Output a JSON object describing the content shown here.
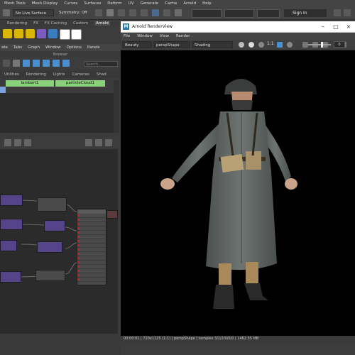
{
  "maya": {
    "menubar": [
      "Mesh Tools",
      "Mesh Display",
      "Curves",
      "Surfaces",
      "Deform",
      "UV",
      "Generate",
      "Cache",
      "Arnold",
      "Help"
    ],
    "status_line": {
      "live_surface": "No Live Surface",
      "symmetry": "Symmetry: Off",
      "sign_in": "Sign In"
    },
    "shelf_tabs": [
      "Rendering",
      "FX",
      "FX Caching",
      "Custom",
      "Arnold"
    ],
    "shelf_active": "Arnold"
  },
  "hypershade": {
    "menu": [
      "ate",
      "Tabs",
      "Graph",
      "Window",
      "Options",
      "Panels"
    ],
    "browser_title": "Browser",
    "search_placeholder": "Search...",
    "tabs": [
      "Utilities",
      "Rendering",
      "Lights",
      "Cameras",
      "Shad"
    ],
    "materials": [
      "lambert1",
      "particleCloud1"
    ]
  },
  "render_view": {
    "title": "Arnold RenderView",
    "menu": [
      "File",
      "Window",
      "View",
      "Render"
    ],
    "aov": "Beauty",
    "camera": "perspShape",
    "shading": "Shading",
    "zoom": "1:1",
    "exposure": "0",
    "status": "00:00:01 | 720x1125 (1:1) | perspShape | samples 3/2/2/0/0/0 | 1462.55 MB"
  },
  "colors": {
    "material_green": "#8bd07a",
    "accent_blue": "#2a7ab0",
    "node_purple": "#56448a"
  }
}
